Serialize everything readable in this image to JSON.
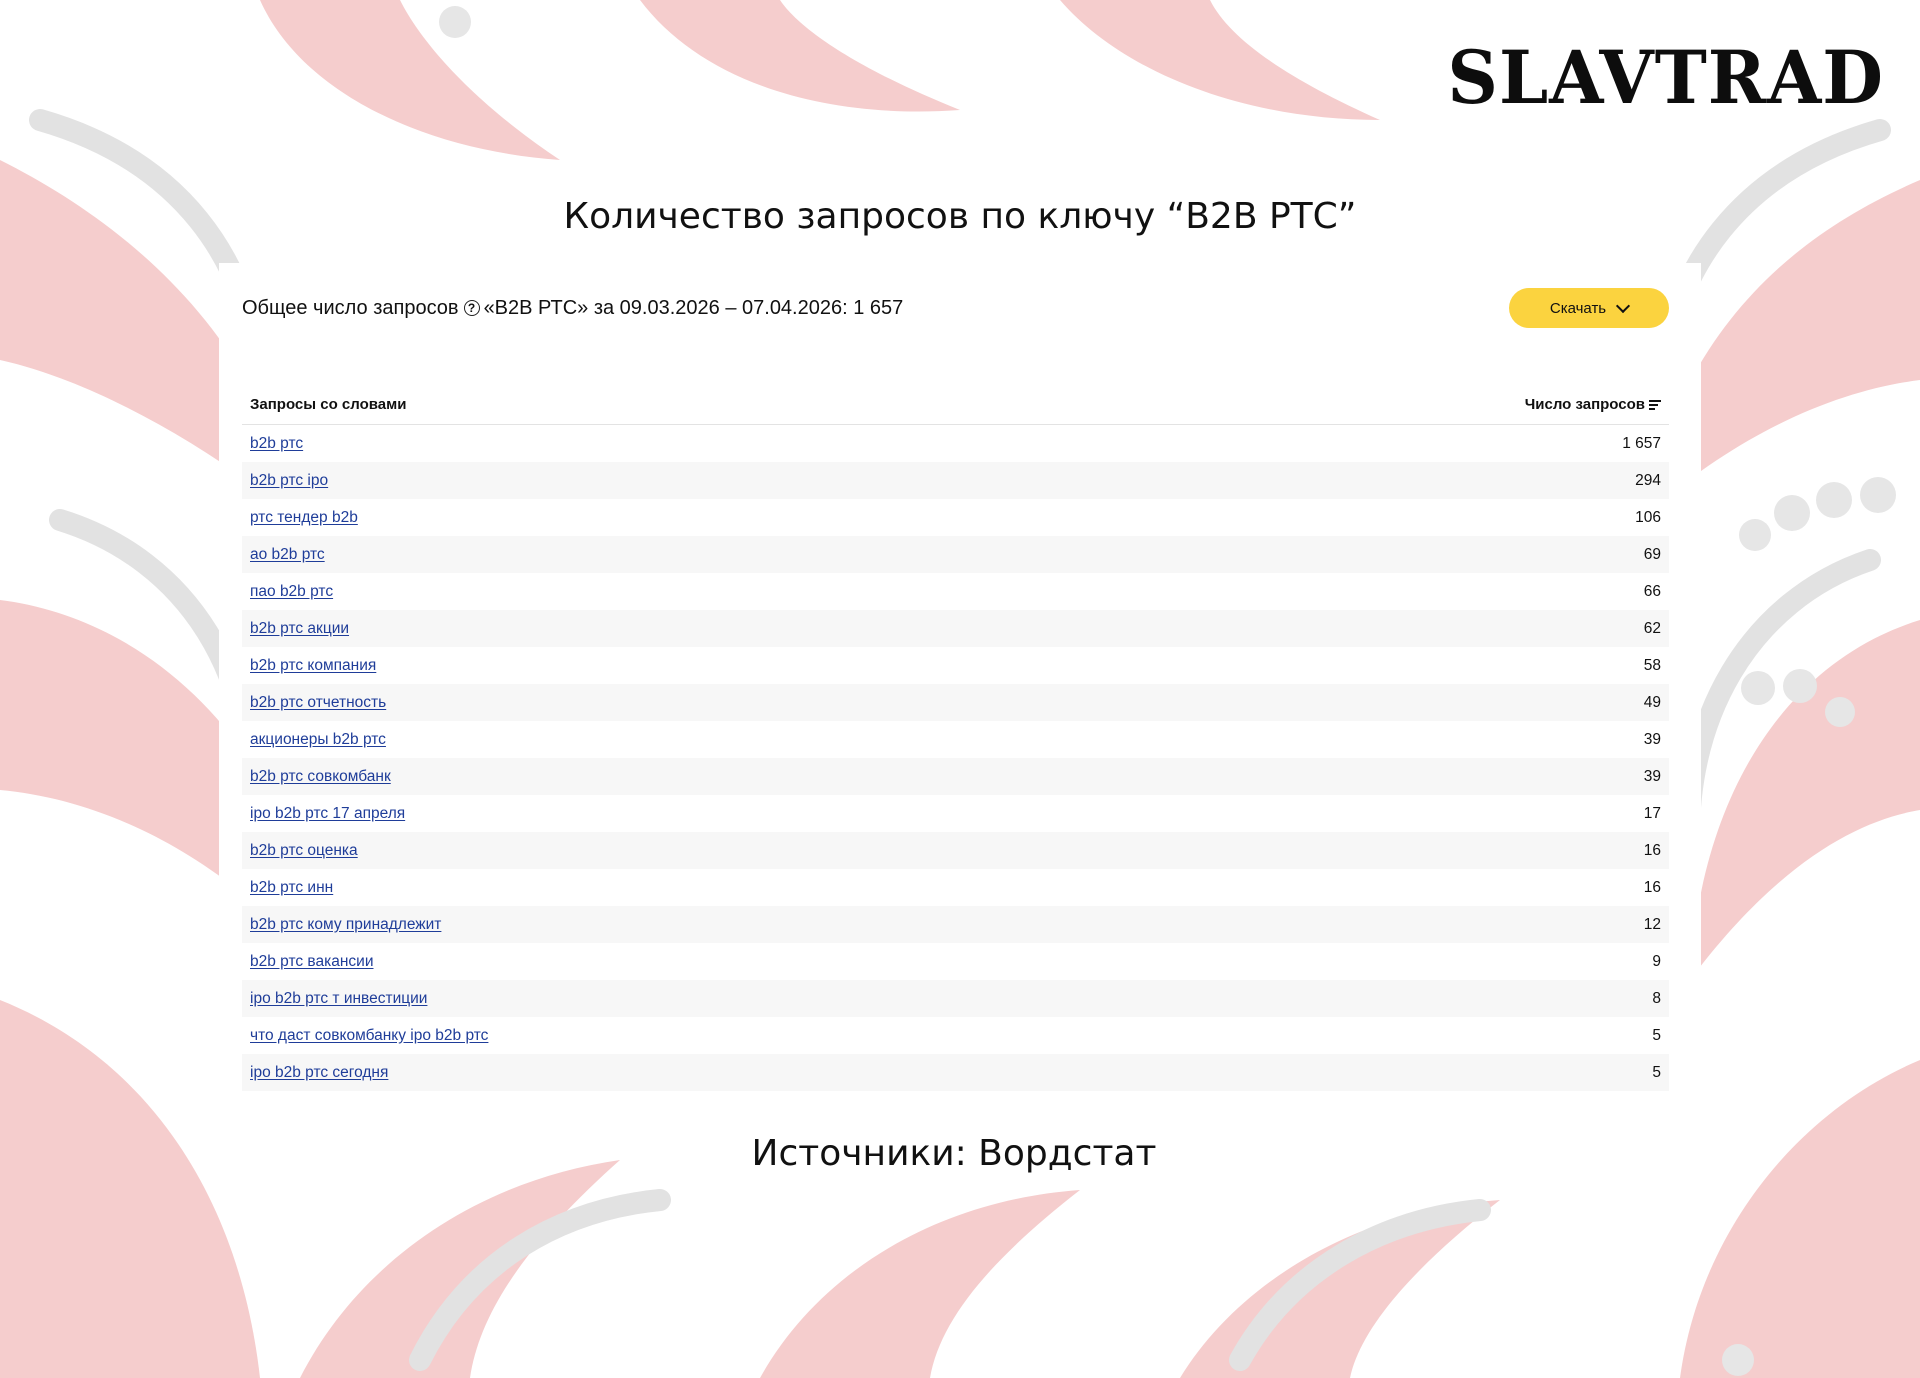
{
  "logo": "SLAVTRAD",
  "slide_title": "Количество запросов по ключу “B2B РТС”",
  "summary": {
    "prefix": "Общее число запросов",
    "suffix": "«B2B РТС» за 09.03.2026 – 07.04.2026: 1 657"
  },
  "download_label": "Скачать",
  "table": {
    "col_query": "Запросы со словами",
    "col_count": "Число запросов",
    "rows": [
      {
        "query": "b2b ртс",
        "count": "1 657"
      },
      {
        "query": "b2b ртс ipo",
        "count": "294"
      },
      {
        "query": "ртс тендер b2b",
        "count": "106"
      },
      {
        "query": "ао b2b ртс",
        "count": "69"
      },
      {
        "query": "пао b2b ртс",
        "count": "66"
      },
      {
        "query": "b2b ртс акции",
        "count": "62"
      },
      {
        "query": "b2b ртс компания",
        "count": "58"
      },
      {
        "query": "b2b ртс отчетность",
        "count": "49"
      },
      {
        "query": "акционеры b2b ртс",
        "count": "39"
      },
      {
        "query": "b2b ртс совкомбанк",
        "count": "39"
      },
      {
        "query": "ipo b2b ртс 17 апреля",
        "count": "17"
      },
      {
        "query": "b2b ртс оценка",
        "count": "16"
      },
      {
        "query": "b2b ртс инн",
        "count": "16"
      },
      {
        "query": "b2b ртс кому принадлежит",
        "count": "12"
      },
      {
        "query": "b2b ртс вакансии",
        "count": "9"
      },
      {
        "query": "ipo b2b ртс т инвестиции",
        "count": "8"
      },
      {
        "query": "что даст совкомбанку ipo b2b ртс",
        "count": "5"
      },
      {
        "query": "ipo b2b ртс сегодня",
        "count": "5"
      }
    ]
  },
  "source": "Источники: Вордстат",
  "colors": {
    "accent_button": "#fbd33f",
    "link": "#1f3d99",
    "ornament_red": "#f2c4c4",
    "ornament_grey": "#e4e4e4"
  }
}
